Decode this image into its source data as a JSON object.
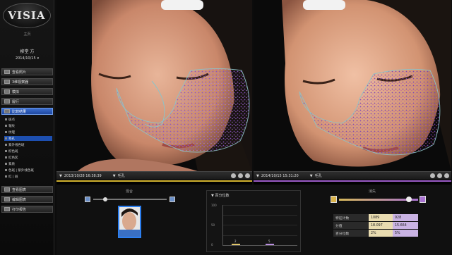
{
  "app": {
    "logo_text": "VISIA",
    "home_label": "主页"
  },
  "patient": {
    "name": "柳堂 方",
    "date": "2014/10/15"
  },
  "sidebar": {
    "items": [
      {
        "label": "查看照片",
        "icon": "photo-icon"
      },
      {
        "label": "3维视察器",
        "icon": "cube-icon"
      },
      {
        "label": "模拟",
        "icon": "wand-icon"
      },
      {
        "label": "履行",
        "icon": "run-icon"
      },
      {
        "label": "比较结果",
        "icon": "compare-icon"
      }
    ],
    "subitems": [
      "斑点",
      "皱纹",
      "纹理",
      "毛孔",
      "紫外线色斑",
      "棕色斑",
      "红色区",
      "紫质",
      "色斑 | 紫外线色斑",
      "红 | 斑"
    ],
    "bottom_items": [
      {
        "label": "查看图表",
        "icon": "chart-icon"
      },
      {
        "label": "编辑图表",
        "icon": "edit-chart-icon"
      },
      {
        "label": "打印报告",
        "icon": "printer-icon"
      }
    ]
  },
  "left_panel": {
    "timestamp": "2013/10/28 16:38:39",
    "mode": "毛孔"
  },
  "right_panel": {
    "timestamp": "2014/10/15 15:31:20",
    "mode": "毛孔"
  },
  "bottom": {
    "blend_title": "混合",
    "graph_title": "百分位数",
    "graph_y_ticks": [
      "100",
      "50",
      "0"
    ],
    "graph_bar_labels": [
      "2",
      "5"
    ],
    "saturation_title": "消失",
    "stats": [
      {
        "label": "特征计数",
        "a": "1089",
        "b": "928"
      },
      {
        "label": "分值",
        "a": "18.097",
        "b": "15.664"
      },
      {
        "label": "百分位数",
        "a": "2%",
        "b": "5%"
      }
    ],
    "colors": {
      "left_accent": "#d3b330",
      "right_accent": "#9c5cc8",
      "active_blue": "#1f48a0"
    }
  }
}
